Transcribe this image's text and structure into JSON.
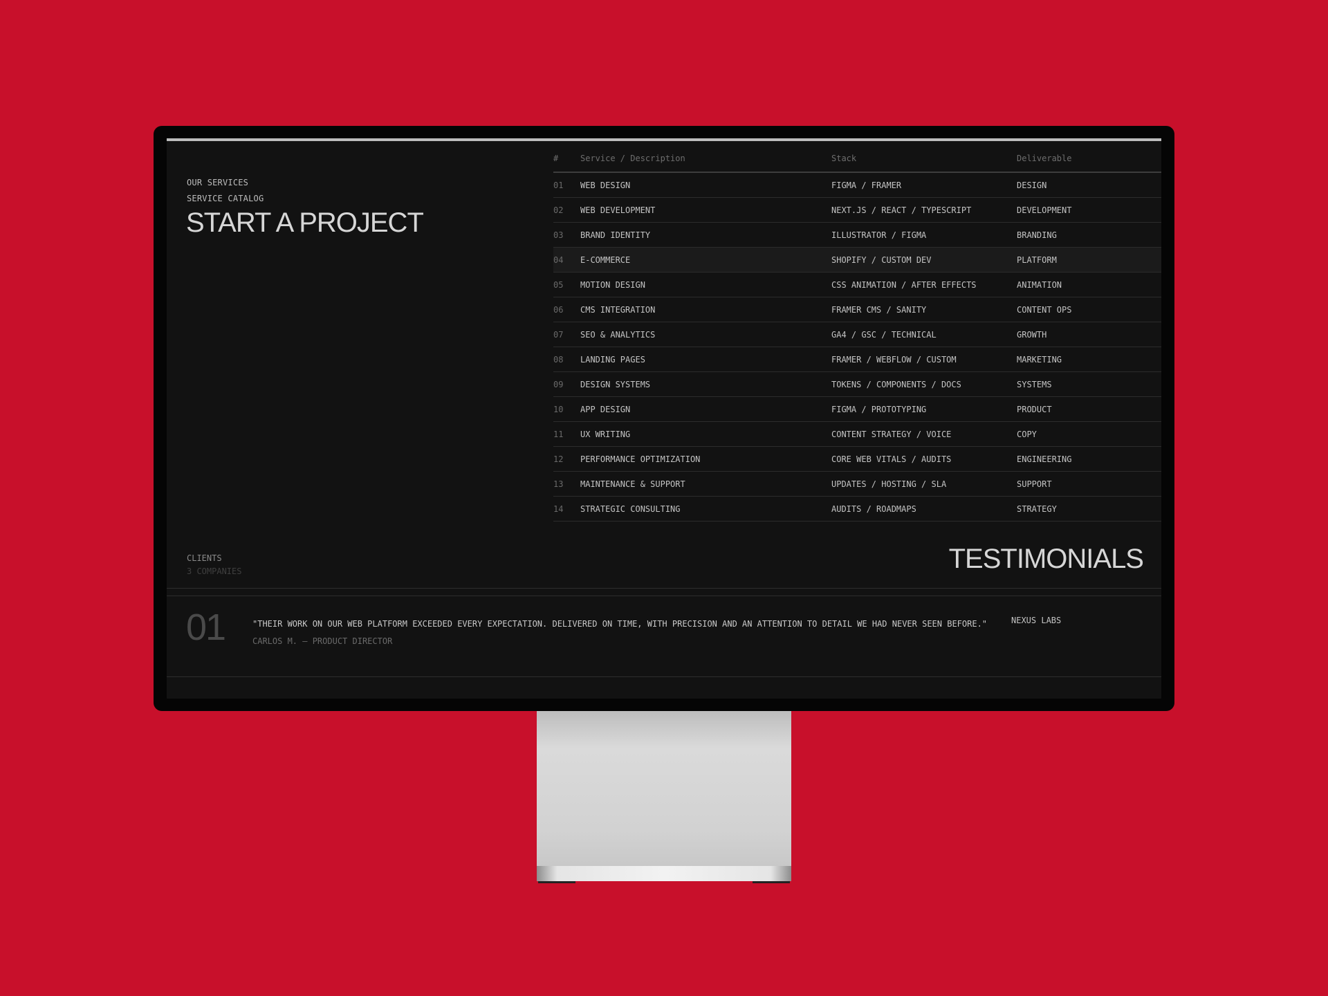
{
  "left": {
    "eyebrow_1": "OUR SERVICES",
    "eyebrow_2": "SERVICE CATALOG",
    "title": "START A PROJECT"
  },
  "table": {
    "headers": [
      "#",
      "Service / Description",
      "Stack",
      "Deliverable"
    ],
    "rows": [
      {
        "num": "01",
        "service": "WEB DESIGN",
        "stack": "FIGMA / FRAMER",
        "deliverable": "DESIGN"
      },
      {
        "num": "02",
        "service": "WEB DEVELOPMENT",
        "stack": "NEXT.JS / REACT / TYPESCRIPT",
        "deliverable": "DEVELOPMENT"
      },
      {
        "num": "03",
        "service": "BRAND IDENTITY",
        "stack": "ILLUSTRATOR / FIGMA",
        "deliverable": "BRANDING"
      },
      {
        "num": "04",
        "service": "E-COMMERCE",
        "stack": "SHOPIFY / CUSTOM DEV",
        "deliverable": "PLATFORM"
      },
      {
        "num": "05",
        "service": "MOTION DESIGN",
        "stack": "CSS ANIMATION / AFTER EFFECTS",
        "deliverable": "ANIMATION"
      },
      {
        "num": "06",
        "service": "CMS INTEGRATION",
        "stack": "FRAMER CMS / SANITY",
        "deliverable": "CONTENT OPS"
      },
      {
        "num": "07",
        "service": "SEO & ANALYTICS",
        "stack": "GA4 / GSC / TECHNICAL",
        "deliverable": "GROWTH"
      },
      {
        "num": "08",
        "service": "LANDING PAGES",
        "stack": "FRAMER / WEBFLOW / CUSTOM",
        "deliverable": "MARKETING"
      },
      {
        "num": "09",
        "service": "DESIGN SYSTEMS",
        "stack": "TOKENS / COMPONENTS / DOCS",
        "deliverable": "SYSTEMS"
      },
      {
        "num": "10",
        "service": "APP DESIGN",
        "stack": "FIGMA / PROTOTYPING",
        "deliverable": "PRODUCT"
      },
      {
        "num": "11",
        "service": "UX WRITING",
        "stack": "CONTENT STRATEGY / VOICE",
        "deliverable": "COPY"
      },
      {
        "num": "12",
        "service": "PERFORMANCE OPTIMIZATION",
        "stack": "CORE WEB VITALS / AUDITS",
        "deliverable": "ENGINEERING"
      },
      {
        "num": "13",
        "service": "MAINTENANCE & SUPPORT",
        "stack": "UPDATES / HOSTING / SLA",
        "deliverable": "SUPPORT"
      },
      {
        "num": "14",
        "service": "STRATEGIC CONSULTING",
        "stack": "AUDITS / ROADMAPS",
        "deliverable": "STRATEGY"
      }
    ]
  },
  "clients": {
    "label": "CLIENTS",
    "count": "3 COMPANIES"
  },
  "testimonials": {
    "title": "TESTIMONIALS",
    "items": [
      {
        "num": "01",
        "quote": "\"THEIR WORK ON OUR WEB PLATFORM EXCEEDED EVERY EXPECTATION. DELIVERED ON TIME, WITH PRECISION AND AN ATTENTION TO DETAIL WE HAD NEVER SEEN BEFORE.\"",
        "author": "CARLOS M. — PRODUCT DIRECTOR",
        "company": "NEXUS LABS"
      }
    ]
  },
  "colors": {
    "background": "#c8102b",
    "screen": "#121212",
    "text": "#c4c4c4",
    "muted": "#6a6a6a"
  }
}
